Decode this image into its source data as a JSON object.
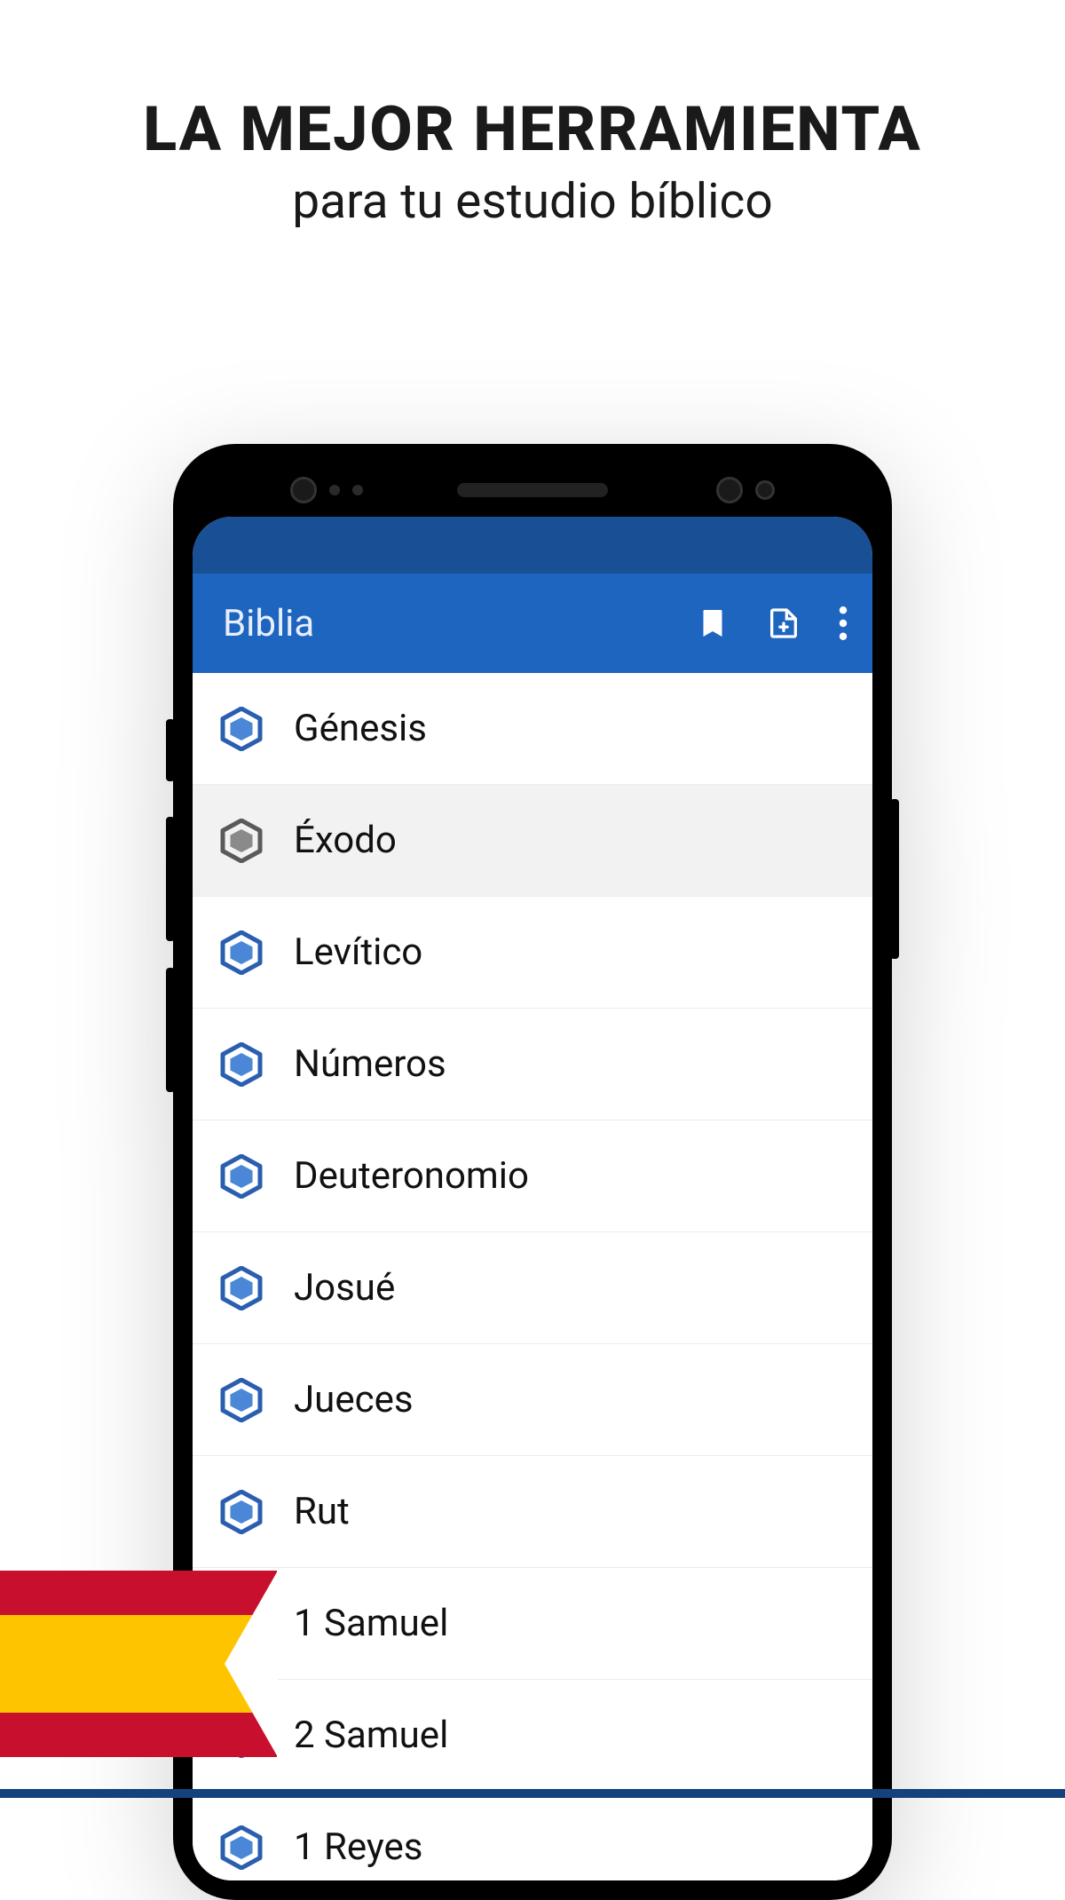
{
  "headline": {
    "title": "LA MEJOR HERRAMIENTA",
    "subtitle": "para tu estudio bíblico"
  },
  "appbar": {
    "title": "Biblia",
    "icons": {
      "bookmark": "bookmark-icon",
      "add_note": "add-note-icon",
      "overflow": "more-vertical-icon"
    }
  },
  "books": [
    {
      "label": "Génesis",
      "selected": false,
      "icon_muted": false
    },
    {
      "label": "Éxodo",
      "selected": true,
      "icon_muted": true
    },
    {
      "label": "Levítico",
      "selected": false,
      "icon_muted": false
    },
    {
      "label": "Números",
      "selected": false,
      "icon_muted": false
    },
    {
      "label": "Deuteronomio",
      "selected": false,
      "icon_muted": false
    },
    {
      "label": "Josué",
      "selected": false,
      "icon_muted": false
    },
    {
      "label": "Jueces",
      "selected": false,
      "icon_muted": false
    },
    {
      "label": "Rut",
      "selected": false,
      "icon_muted": false
    },
    {
      "label": "1 Samuel",
      "selected": false,
      "icon_muted": false
    },
    {
      "label": "2 Samuel",
      "selected": false,
      "icon_muted": false
    },
    {
      "label": "1 Reyes",
      "selected": false,
      "icon_muted": false
    }
  ],
  "colors": {
    "accent": "#1e65c0",
    "accent_dark": "#184f95",
    "hex_stroke": "#2a5fb0",
    "hex_fill": "#4a87d6",
    "hex_muted_stroke": "#5a5a5a",
    "hex_muted_fill": "#8a8a8a"
  },
  "flag": {
    "country": "Spain",
    "colors": [
      "#c8102e",
      "#ffc400",
      "#c8102e"
    ]
  }
}
